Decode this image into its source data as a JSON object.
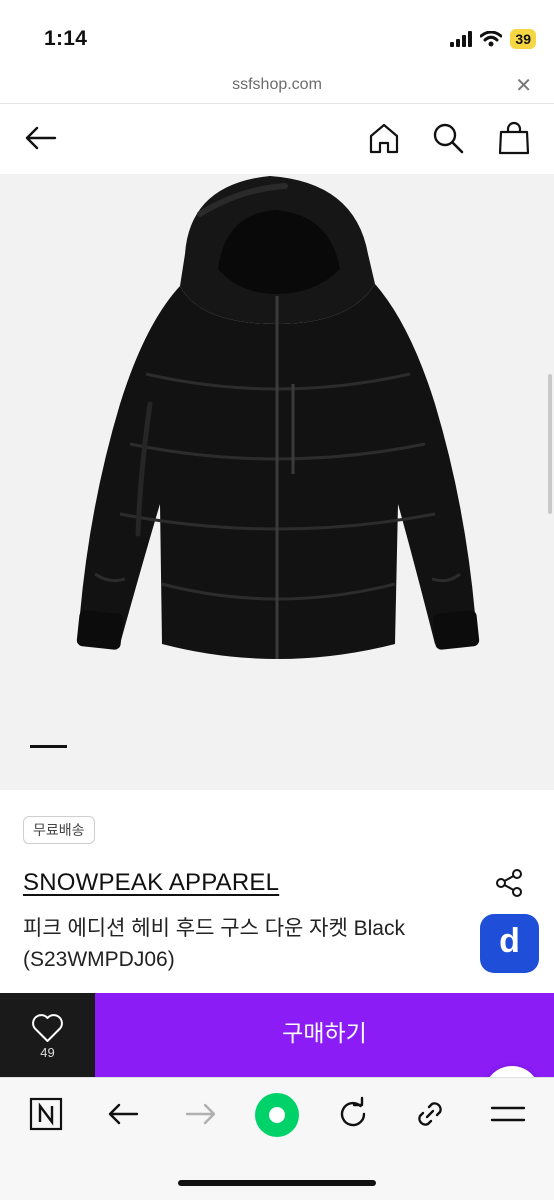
{
  "status_bar": {
    "time": "1:14",
    "battery": "39"
  },
  "browser": {
    "url": "ssfshop.com",
    "close_glyph": "✕"
  },
  "header": {
    "icons": [
      "back-arrow-icon",
      "home-icon",
      "search-icon",
      "shopping-bag-icon"
    ]
  },
  "product": {
    "image": "black-hooded-down-jacket",
    "badge": "무료배송",
    "brand": "SNOWPEAK APPAREL",
    "name": "피크 에디션 헤비 후드 구스 다운 자켓 Black (S23WMPDJ06)",
    "d_button_label": "d"
  },
  "purchase": {
    "wish_count": "49",
    "buy_label": "구매하기"
  },
  "toolbar": {
    "icons": [
      "naver-icon",
      "back-icon",
      "forward-icon",
      "green-dot-icon",
      "refresh-icon",
      "link-icon",
      "menu-icon"
    ]
  },
  "colors": {
    "buy_button": "#8b1cf5",
    "d_button": "#1f4fd8",
    "green_button": "#00d26a",
    "wish_box": "#1a1a1a"
  }
}
